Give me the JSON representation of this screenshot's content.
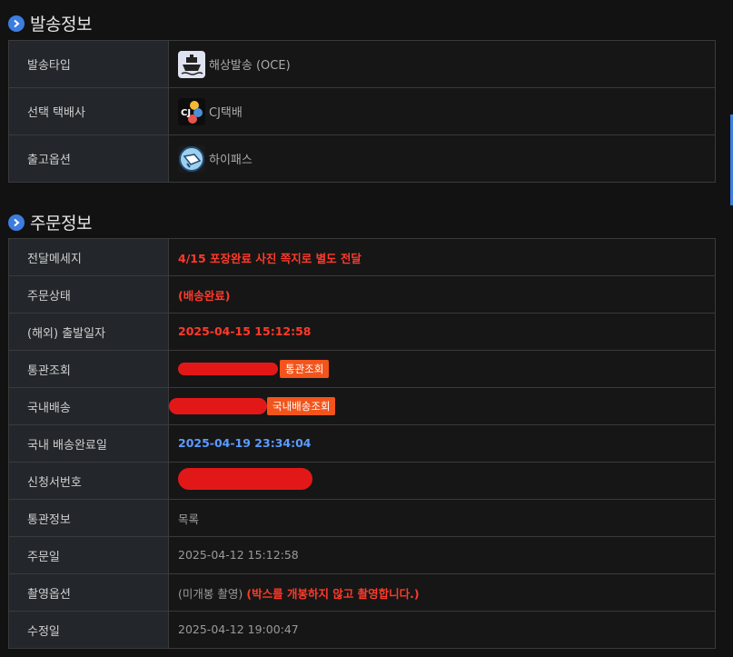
{
  "shipping_section": {
    "title": "발송정보",
    "rows": [
      {
        "label": "발송타입",
        "value": "해상발송 (OCE)",
        "icon": "ship-icon"
      },
      {
        "label": "선택 택배사",
        "value": "CJ택배",
        "icon": "cj-logo-icon"
      },
      {
        "label": "출고옵션",
        "value": "하이패스",
        "icon": "highpass-icon"
      }
    ]
  },
  "order_section": {
    "title": "주문정보",
    "delivery_message": {
      "label": "전달메세지",
      "value": "4/15 포장완료 사진 쪽지로 별도 전달"
    },
    "order_status": {
      "label": "주문상태",
      "value": "(배송완료)"
    },
    "departure_date": {
      "label": "(해외) 출발일자",
      "value": "2025-04-15 15:12:58"
    },
    "customs_lookup": {
      "label": "통관조회",
      "button": "통관조회"
    },
    "domestic_shipping": {
      "label": "국내배송",
      "button": "국내배송조회"
    },
    "domestic_complete_date": {
      "label": "국내 배송완료일",
      "value": "2025-04-19 23:34:04"
    },
    "application_number": {
      "label": "신청서번호"
    },
    "customs_info": {
      "label": "통관정보",
      "value": "목록"
    },
    "order_date": {
      "label": "주문일",
      "value": "2025-04-12 15:12:58"
    },
    "photo_option": {
      "label": "촬영옵션",
      "value": "(미개봉 촬영)",
      "note": "(박스를 개봉하지 않고 촬영합니다.)"
    },
    "modified_date": {
      "label": "수정일",
      "value": "2025-04-12 19:00:47"
    }
  },
  "colors": {
    "accent": "#3d7de0",
    "danger": "#ff3a2a",
    "button": "#f2541b",
    "link_blue": "#5b9bff"
  }
}
